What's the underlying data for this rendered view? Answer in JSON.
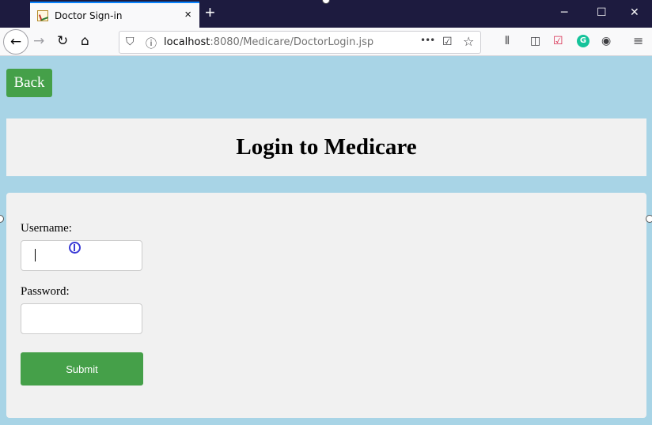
{
  "browser": {
    "tab": {
      "title": "Doctor Sign-in",
      "close": "×"
    },
    "new_tab": "+",
    "window_controls": {
      "minimize": "─",
      "maximize": "☐",
      "close": "✕"
    },
    "nav": {
      "back": "←",
      "forward": "→",
      "reload": "↻",
      "home": "⌂"
    },
    "url": {
      "host": "localhost",
      "rest": ":8080/Medicare/DoctorLogin.jsp"
    },
    "url_icons": {
      "shield": "⛉",
      "info": "ⓘ",
      "more": "•••",
      "pocket": "☑",
      "bookmark": "☆"
    },
    "toolbar_icons": {
      "library": "⫴",
      "reader": "◫",
      "pocket": "☑",
      "grammarly": "G",
      "account": "◉",
      "menu": "≡"
    }
  },
  "page": {
    "back_label": "Back",
    "title": "Login to Medicare",
    "form": {
      "username_label": "Username:",
      "username_value": "",
      "password_label": "Password:",
      "password_value": "",
      "submit_label": "Submit"
    }
  },
  "colors": {
    "page_background": "#a8d4e6",
    "panel": "#f1f1f1",
    "button": "#45a049",
    "tab_strip": "#1d1b3f"
  }
}
